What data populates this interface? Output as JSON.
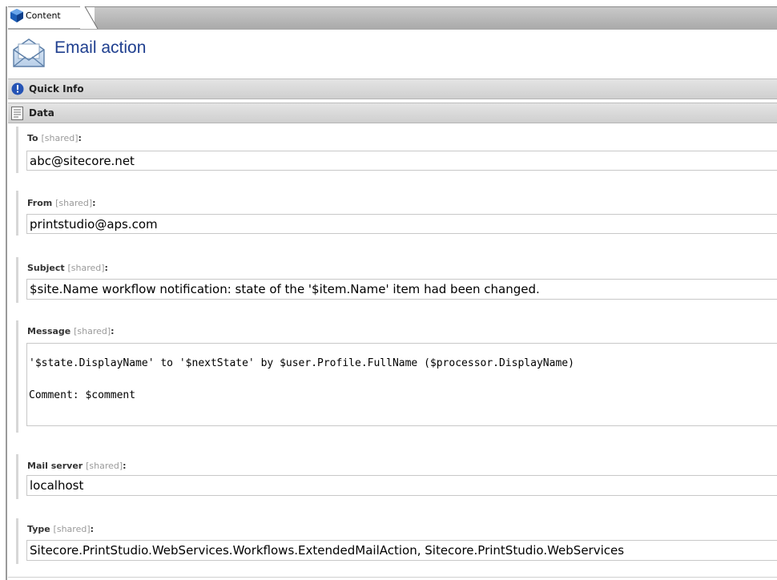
{
  "tab": {
    "label": "Content",
    "icon": "cube-icon"
  },
  "header": {
    "title": "Email action",
    "icon": "envelope-icon"
  },
  "sections": {
    "quick_info": {
      "label": "Quick Info",
      "icon": "info-icon"
    },
    "data": {
      "label": "Data",
      "icon": "document-icon"
    }
  },
  "fields": {
    "to": {
      "label": "To",
      "shared": "[shared]",
      "colon": ":",
      "value": "abc@sitecore.net"
    },
    "from": {
      "label": "From",
      "shared": "[shared]",
      "colon": ":",
      "value": "printstudio@aps.com"
    },
    "subject": {
      "label": "Subject",
      "shared": "[shared]",
      "colon": ":",
      "value": "$site.Name workflow notification: state of the '$item.Name' item had been changed."
    },
    "message": {
      "label": "Message",
      "shared": "[shared]",
      "colon": ":",
      "line1": "'$state.DisplayName' to '$nextState' by $user.Profile.FullName ($processor.DisplayName)",
      "line2": "Comment: $comment"
    },
    "mail_server": {
      "label": "Mail server",
      "shared": "[shared]",
      "colon": ":",
      "value": "localhost"
    },
    "type": {
      "label": "Type",
      "shared": "[shared]",
      "colon": ":",
      "value": "Sitecore.PrintStudio.WebServices.Workflows.ExtendedMailAction, Sitecore.PrintStudio.WebServices"
    }
  },
  "colors": {
    "title": "#1f3f8f",
    "section_bg": "#d8d8d8",
    "tab_bar": "#b0b0b0"
  }
}
